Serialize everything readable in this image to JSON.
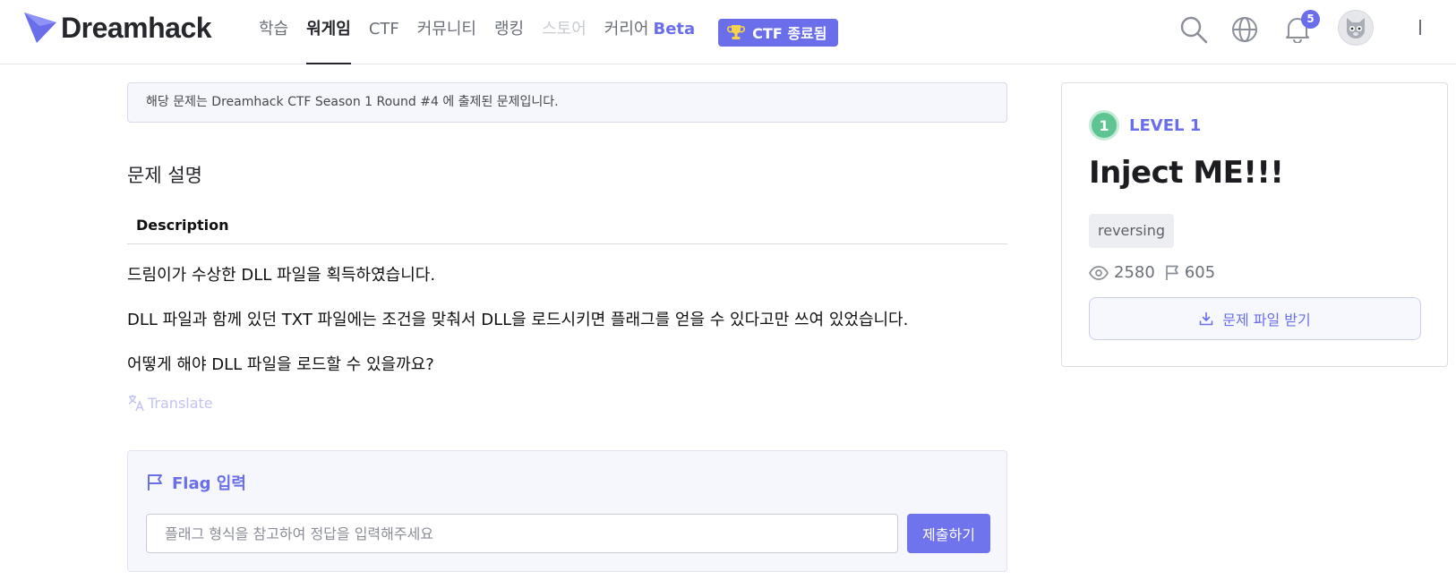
{
  "header": {
    "logo_text": "Dreamhack",
    "nav": [
      {
        "label": "학습"
      },
      {
        "label": "워게임"
      },
      {
        "label": "CTF"
      },
      {
        "label": "커뮤니티"
      },
      {
        "label": "랭킹"
      },
      {
        "label": "스토어"
      },
      {
        "label": "커리어"
      }
    ],
    "beta_label": "Beta",
    "ctf_badge": "CTF 종료됨",
    "notification_count": "5"
  },
  "notice": "해당 문제는 Dreamhack CTF Season 1 Round #4 에 출제된 문제입니다.",
  "description": {
    "section_title": "문제 설명",
    "heading": "Description",
    "paragraphs": [
      "드림이가 수상한 DLL 파일을 획득하였습니다.",
      "DLL 파일과 함께 있던 TXT 파일에는 조건을 맞춰서 DLL을 로드시키면 플래그를 얻을 수 있다고만 쓰여 있었습니다.",
      "어떻게 해야 DLL 파일을 로드할 수 있을까요?"
    ],
    "translate_label": "Translate"
  },
  "flag": {
    "title": "Flag 입력",
    "placeholder": "플래그 형식을 참고하여 정답을 입력해주세요",
    "submit_label": "제출하기"
  },
  "challenge": {
    "level_number": "1",
    "level_label": "LEVEL 1",
    "title": "Inject ME!!!",
    "tag": "reversing",
    "views": "2580",
    "solves": "605",
    "download_label": "문제 파일 받기"
  },
  "colors": {
    "accent": "#6a6eea",
    "level_green": "#5dc492"
  }
}
